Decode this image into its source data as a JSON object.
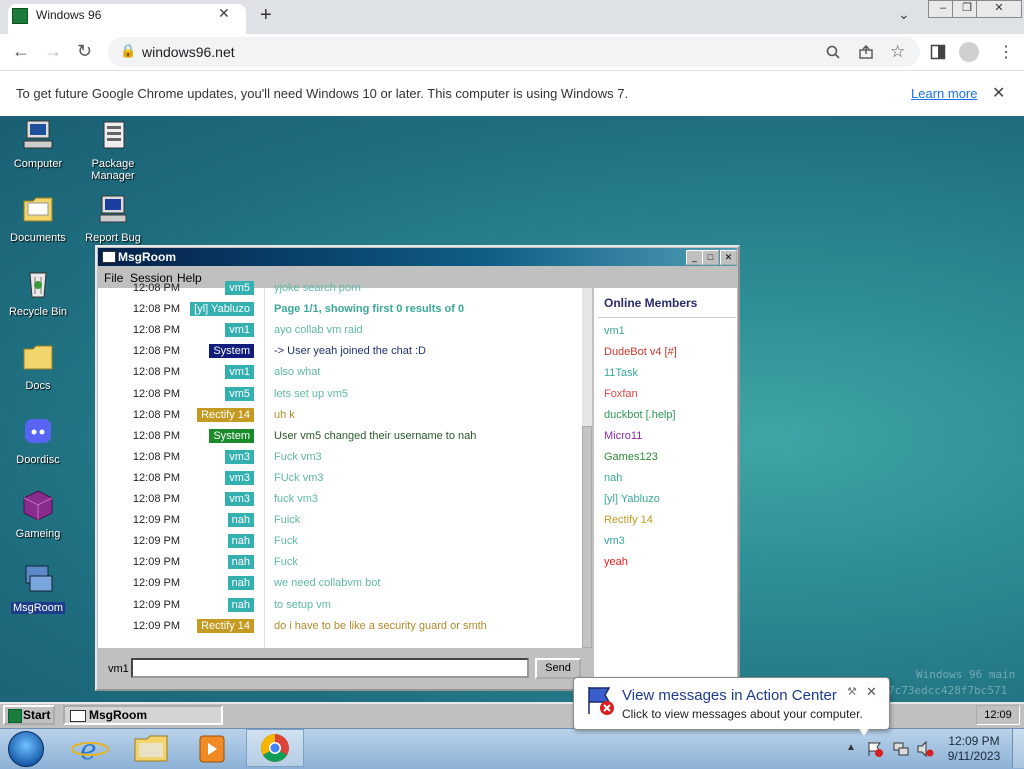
{
  "browser": {
    "tab_title": "Windows 96",
    "tab_close": "✕",
    "new_tab": "+",
    "url": "windows96.net",
    "infobar_text": "To get future Google Chrome updates, you'll need Windows 10 or later. This computer is using Windows 7.",
    "infobar_link": "Learn more",
    "infobar_close": "✕"
  },
  "desktop_icons": [
    {
      "label": "Computer"
    },
    {
      "label": "Package Manager"
    },
    {
      "label": "Documents"
    },
    {
      "label": "Report Bug"
    },
    {
      "label": "Recycle Bin"
    },
    {
      "label": "Docs"
    },
    {
      "label": "Doordisc"
    },
    {
      "label": "Gameing"
    },
    {
      "label": "MsgRoom"
    }
  ],
  "watermark": {
    "line1": "Windows 96 main",
    "line2": "7c73edcc428f7bc571"
  },
  "msgroom": {
    "title": "MsgRoom",
    "menu": [
      "File",
      "Session",
      "Help"
    ],
    "members_heading": "Online Members",
    "members": [
      {
        "name": "vm1",
        "color": "#3aa89a"
      },
      {
        "name": "DudeBot v4 [#]",
        "color": "#c0392b"
      },
      {
        "name": "11Task",
        "color": "#3aa89a"
      },
      {
        "name": "Foxfan",
        "color": "#e04848"
      },
      {
        "name": "duckbot [.help]",
        "color": "#2e9a5a"
      },
      {
        "name": "Micro11",
        "color": "#8e2aa8"
      },
      {
        "name": "Games123",
        "color": "#2e8a3a"
      },
      {
        "name": "nah",
        "color": "#3aa89a"
      },
      {
        "name": "[yl] Yabluzo",
        "color": "#3aa89a"
      },
      {
        "name": "Rectify 14",
        "color": "#c49a22"
      },
      {
        "name": "vm3",
        "color": "#3aa89a"
      },
      {
        "name": "yeah",
        "color": "#e02020"
      }
    ],
    "messages": [
      {
        "time": "12:08 PM",
        "user": "vm5",
        "color": "#35b0b0",
        "text": "yjoke search porn",
        "style": ""
      },
      {
        "time": "12:08 PM",
        "user": "[yl] Yabluzo",
        "color": "#35b0b0",
        "text": "Page 1/1, showing first 0 results of 0",
        "style": "bold"
      },
      {
        "time": "12:08 PM",
        "user": "vm1",
        "color": "#35b0b0",
        "text": "ayo collab vm raid",
        "style": ""
      },
      {
        "time": "12:08 PM",
        "user": "System",
        "color": "#101c7a",
        "text": "-> User yeah joined the chat :D",
        "style": "sys"
      },
      {
        "time": "12:08 PM",
        "user": "vm1",
        "color": "#35b0b0",
        "text": "also what",
        "style": ""
      },
      {
        "time": "12:08 PM",
        "user": "vm5",
        "color": "#35b0b0",
        "text": "lets set up vm5",
        "style": ""
      },
      {
        "time": "12:08 PM",
        "user": "Rectify 14",
        "color": "#c49a22",
        "text": "uh k",
        "style": "gold"
      },
      {
        "time": "12:08 PM",
        "user": "System",
        "color": "#1a8a2a",
        "text": "User vm5 changed their username to nah",
        "style": "sys2"
      },
      {
        "time": "12:08 PM",
        "user": "vm3",
        "color": "#35b0b0",
        "text": "Fuck vm3",
        "style": ""
      },
      {
        "time": "12:08 PM",
        "user": "vm3",
        "color": "#35b0b0",
        "text": "FUck vm3",
        "style": ""
      },
      {
        "time": "12:08 PM",
        "user": "vm3",
        "color": "#35b0b0",
        "text": "fuck vm3",
        "style": ""
      },
      {
        "time": "12:09 PM",
        "user": "nah",
        "color": "#35b0b0",
        "text": "Fuick",
        "style": ""
      },
      {
        "time": "12:09 PM",
        "user": "nah",
        "color": "#35b0b0",
        "text": "Fuck",
        "style": ""
      },
      {
        "time": "12:09 PM",
        "user": "nah",
        "color": "#35b0b0",
        "text": "Fuck",
        "style": ""
      },
      {
        "time": "12:09 PM",
        "user": "nah",
        "color": "#35b0b0",
        "text": "we need collabvm bot",
        "style": ""
      },
      {
        "time": "12:09 PM",
        "user": "nah",
        "color": "#35b0b0",
        "text": "to setup vm",
        "style": ""
      },
      {
        "time": "12:09 PM",
        "user": "Rectify 14",
        "color": "#c49a22",
        "text": "do i have to be like a security guard or smth",
        "style": "gold"
      }
    ],
    "input_label": "vm1",
    "input_value": "",
    "send_label": "Send"
  },
  "w96_taskbar": {
    "start_label": "Start",
    "task_label": "MsgRoom",
    "clock": "12:09"
  },
  "action_center": {
    "title": "View messages in Action Center",
    "subtitle": "Click to view messages about your computer.",
    "close": "✕"
  },
  "win7": {
    "time": "12:09 PM",
    "date": "9/11/2023"
  }
}
